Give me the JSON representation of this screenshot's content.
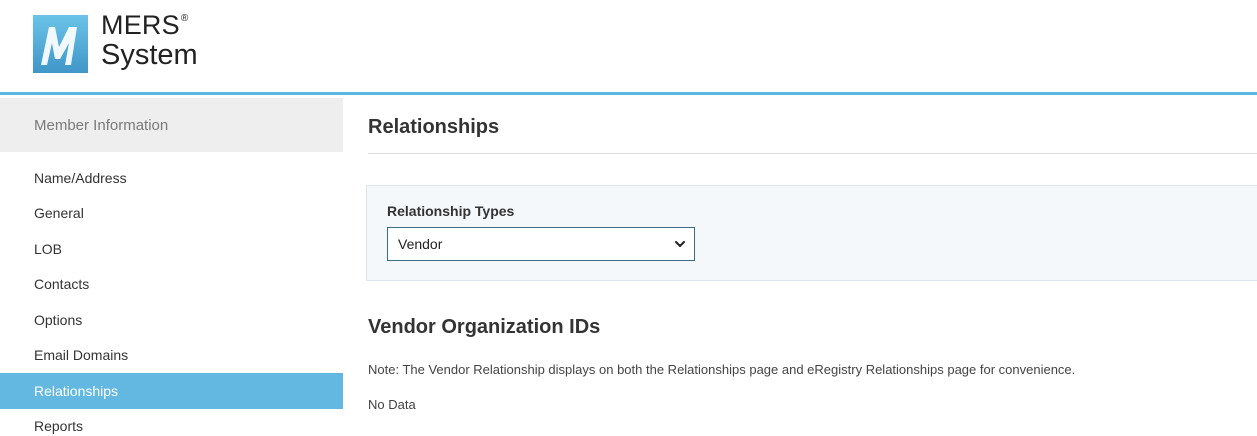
{
  "header": {
    "logo_line1": "MERS",
    "logo_mark_reg": "®",
    "logo_line2": "System"
  },
  "sidebar": {
    "section_header": "Member Information",
    "items": [
      {
        "label": "Name/Address"
      },
      {
        "label": "General"
      },
      {
        "label": "LOB"
      },
      {
        "label": "Contacts"
      },
      {
        "label": "Options"
      },
      {
        "label": "Email Domains"
      },
      {
        "label": "Relationships",
        "active": true
      },
      {
        "label": "Reports"
      }
    ]
  },
  "main": {
    "title": "Relationships",
    "relationship_types": {
      "label": "Relationship Types",
      "selected": "Vendor"
    },
    "section_title": "Vendor Organization IDs",
    "note": "Note: The Vendor Relationship displays on both the Relationships page and eRegistry Relationships page for convenience.",
    "empty_text": "No Data"
  },
  "colors": {
    "accent": "#62b8e0",
    "header_rule": "#5bb8e0",
    "panel_bg": "#f4f8fb",
    "select_border": "#3a6d8c"
  },
  "icons": {
    "logo": "mers-logo-icon",
    "select_chevron": "chevron-down-icon"
  }
}
